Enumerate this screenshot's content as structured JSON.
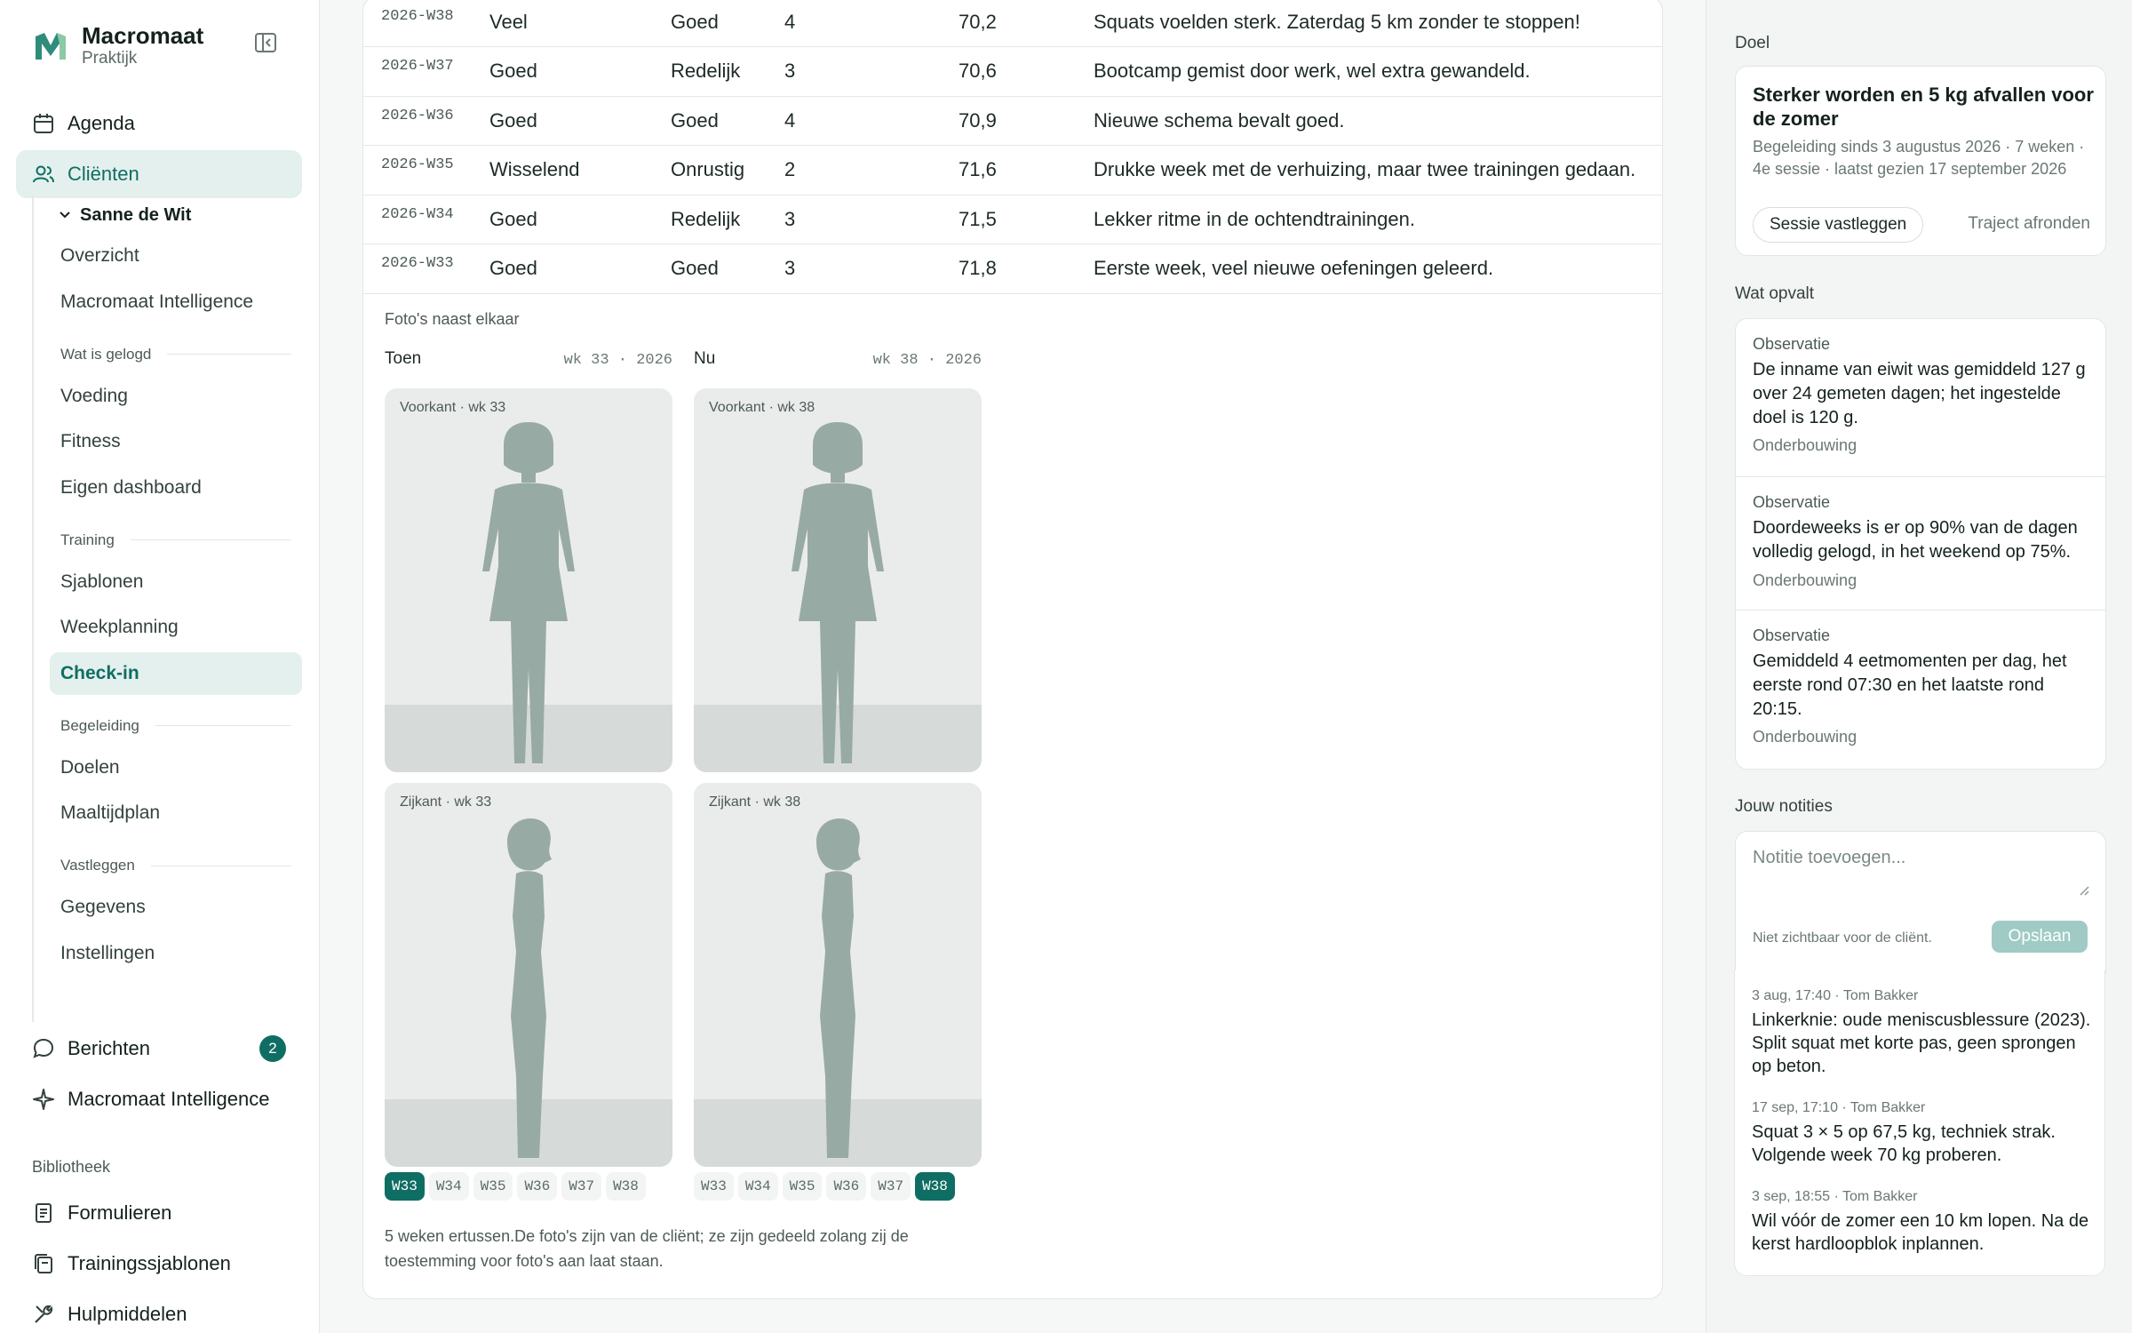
{
  "brand": {
    "name": "Macromaat",
    "sub": "Praktijk"
  },
  "nav": {
    "agenda": "Agenda",
    "clients": "Cliënten",
    "messages": "Berichten",
    "messages_badge": "2",
    "intelligence": "Macromaat Intelligence"
  },
  "client": {
    "name": "Sanne de Wit",
    "overview": "Overzicht",
    "intelligence": "Macromaat Intelligence",
    "groups": {
      "logged": "Wat is gelogd",
      "training": "Training",
      "coaching": "Begeleiding",
      "record": "Vastleggen"
    },
    "items": {
      "food": "Voeding",
      "fitness": "Fitness",
      "dashboard": "Eigen dashboard",
      "templates": "Sjablonen",
      "weekplan": "Weekplanning",
      "checkin": "Check-in",
      "goals": "Doelen",
      "mealplan": "Maaltijdplan",
      "data": "Gegevens",
      "settings": "Instellingen"
    }
  },
  "library": {
    "title": "Bibliotheek",
    "forms": "Formulieren",
    "training_templates": "Trainingssjablonen",
    "resources": "Hulpmiddelen"
  },
  "checkins": [
    {
      "week": "2026-W38",
      "energy": "Veel",
      "sleep": "Goed",
      "trainings": "4",
      "weight": "70,2",
      "note": "Squats voelden sterk. Zaterdag 5 km zonder te stoppen!"
    },
    {
      "week": "2026-W37",
      "energy": "Goed",
      "sleep": "Redelijk",
      "trainings": "3",
      "weight": "70,6",
      "note": "Bootcamp gemist door werk, wel extra gewandeld."
    },
    {
      "week": "2026-W36",
      "energy": "Goed",
      "sleep": "Goed",
      "trainings": "4",
      "weight": "70,9",
      "note": "Nieuwe schema bevalt goed."
    },
    {
      "week": "2026-W35",
      "energy": "Wisselend",
      "sleep": "Onrustig",
      "trainings": "2",
      "weight": "71,6",
      "note": "Drukke week met de verhuizing, maar twee trainingen gedaan."
    },
    {
      "week": "2026-W34",
      "energy": "Goed",
      "sleep": "Redelijk",
      "trainings": "3",
      "weight": "71,5",
      "note": "Lekker ritme in de ochtendtrainingen."
    },
    {
      "week": "2026-W33",
      "energy": "Goed",
      "sleep": "Goed",
      "trainings": "3",
      "weight": "71,8",
      "note": "Eerste week, veel nieuwe oefeningen geleerd."
    }
  ],
  "photos": {
    "title": "Foto's naast elkaar",
    "before": {
      "label": "Toen",
      "date": "wk 33 · 2026",
      "front": "Voorkant · wk 33",
      "side": "Zijkant · wk 33"
    },
    "after": {
      "label": "Nu",
      "date": "wk 38 · 2026",
      "front": "Voorkant · wk 38",
      "side": "Zijkant · wk 38"
    },
    "weeks": [
      "W33",
      "W34",
      "W35",
      "W36",
      "W37",
      "W38"
    ],
    "before_selected": "W33",
    "after_selected": "W38",
    "note": "5 weken ertussen.De foto's zijn van de cliënt; ze zijn gedeeld zolang zij de toestemming voor foto's aan laat staan."
  },
  "goal": {
    "section": "Doel",
    "title": "Sterker worden en 5 kg afvallen voor de zomer",
    "meta": "Begeleiding sinds 3 augustus 2026 · 7 weken · 4e sessie · laatst gezien 17 september 2026",
    "record_btn": "Sessie vastleggen",
    "finish_btn": "Traject afronden"
  },
  "observations": {
    "section": "Wat opvalt",
    "items": [
      {
        "label": "Observatie",
        "text": "De inname van eiwit was gemiddeld 127 g over 24 gemeten dagen; het ingestelde doel is 120 g.",
        "link": "Onderbouwing"
      },
      {
        "label": "Observatie",
        "text": "Doordeweeks is er op 90% van de dagen volledig gelogd, in het weekend op 75%.",
        "link": "Onderbouwing"
      },
      {
        "label": "Observatie",
        "text": "Gemiddeld 4 eetmomenten per dag, het eerste rond 07:30 en het laatste rond 20:15.",
        "link": "Onderbouwing"
      }
    ]
  },
  "notes": {
    "section": "Jouw notities",
    "placeholder": "Notitie toevoegen...",
    "hint": "Niet zichtbaar voor de cliënt.",
    "save": "Opslaan",
    "entries": [
      {
        "meta": "3 aug, 17:40 · Tom Bakker",
        "body": "Linkerknie: oude meniscusblessure (2023). Split squat met korte pas, geen sprongen op beton."
      },
      {
        "meta": "17 sep, 17:10 · Tom Bakker",
        "body": "Squat 3 × 5 op 67,5 kg, techniek strak. Volgende week 70 kg proberen."
      },
      {
        "meta": "3 sep, 18:55 · Tom Bakker",
        "body": "Wil vóór de zomer een 10 km lopen. Na de kerst hardloopblok inplannen."
      }
    ]
  },
  "colors": {
    "accent": "#0f6e63",
    "accent_soft": "#e3f0ed",
    "figure": "#98aaa4"
  }
}
